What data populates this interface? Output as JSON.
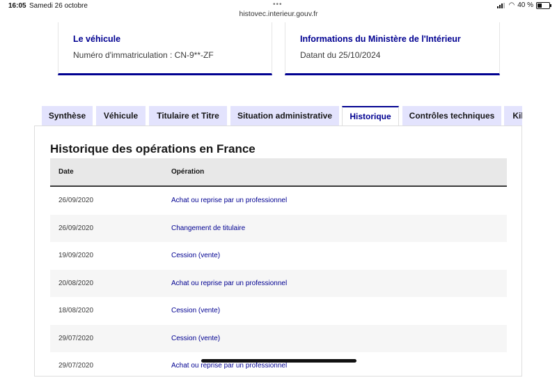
{
  "status_bar": {
    "time": "16:05",
    "date": "Samedi 26 octobre",
    "url": "histovec.interieur.gouv.fr",
    "battery": "40 %",
    "battery_level": 0.4
  },
  "cards": [
    {
      "title": "Le véhicule",
      "text": "Numéro d'immatriculation : CN-9**-ZF"
    },
    {
      "title": "Informations du Ministère de l'Intérieur",
      "text": "Datant du 25/10/2024"
    }
  ],
  "tabs": [
    {
      "label": "Synthèse",
      "active": false
    },
    {
      "label": "Véhicule",
      "active": false
    },
    {
      "label": "Titulaire et Titre",
      "active": false
    },
    {
      "label": "Situation administrative",
      "active": false
    },
    {
      "label": "Historique",
      "active": true
    },
    {
      "label": "Contrôles techniques",
      "active": false
    },
    {
      "label": "Kil",
      "active": false
    }
  ],
  "history": {
    "title": "Historique des opérations en France",
    "columns": {
      "date": "Date",
      "operation": "Opération"
    },
    "rows": [
      {
        "date": "26/09/2020",
        "operation": "Achat ou reprise par un professionnel"
      },
      {
        "date": "26/09/2020",
        "operation": "Changement de titulaire"
      },
      {
        "date": "19/09/2020",
        "operation": "Cession (vente)"
      },
      {
        "date": "20/08/2020",
        "operation": "Achat ou reprise par un professionnel"
      },
      {
        "date": "18/08/2020",
        "operation": "Cession (vente)"
      },
      {
        "date": "29/07/2020",
        "operation": "Cession (vente)"
      },
      {
        "date": "29/07/2020",
        "operation": "Achat ou reprise par un professionnel"
      }
    ]
  },
  "colors": {
    "accent": "#000091",
    "tab_bg": "#e3e3fd"
  }
}
